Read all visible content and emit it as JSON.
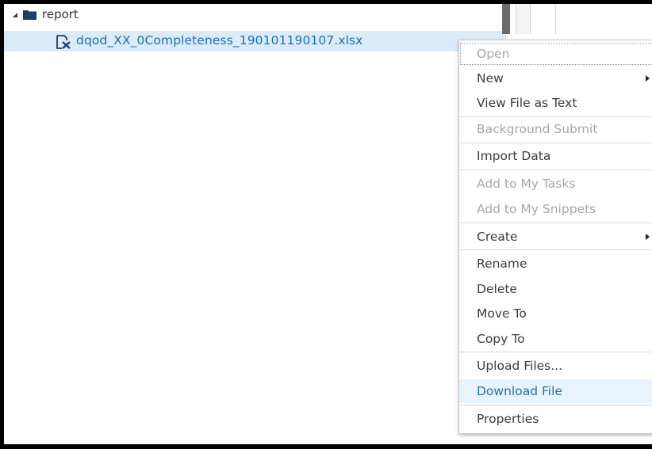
{
  "tree": {
    "folder": {
      "label": "report",
      "icon": "folder-icon"
    },
    "file": {
      "label": "dqod_XX_0Completeness_190101190107.xlsx",
      "icon": "excel-file-icon"
    }
  },
  "context_menu": {
    "items": [
      {
        "label": "Open",
        "state": "disabled"
      },
      {
        "label": "New",
        "submenu": true
      },
      {
        "label": "View File as Text"
      },
      {
        "label": "Background Submit",
        "state": "disabled"
      },
      {
        "label": "Import Data"
      },
      {
        "label": "Add to My Tasks",
        "state": "disabled"
      },
      {
        "label": "Add to My Snippets",
        "state": "disabled"
      },
      {
        "label": "Create",
        "submenu": true
      },
      {
        "label": "Rename"
      },
      {
        "label": "Delete"
      },
      {
        "label": "Move To"
      },
      {
        "label": "Copy To"
      },
      {
        "label": "Upload Files..."
      },
      {
        "label": "Download File",
        "state": "highlighted"
      },
      {
        "label": "Properties"
      }
    ]
  },
  "colors": {
    "selection": "#dcebf8",
    "link": "#1a6fb5",
    "folder": "#1f3c6b",
    "highlight": "#e9f3fb"
  }
}
